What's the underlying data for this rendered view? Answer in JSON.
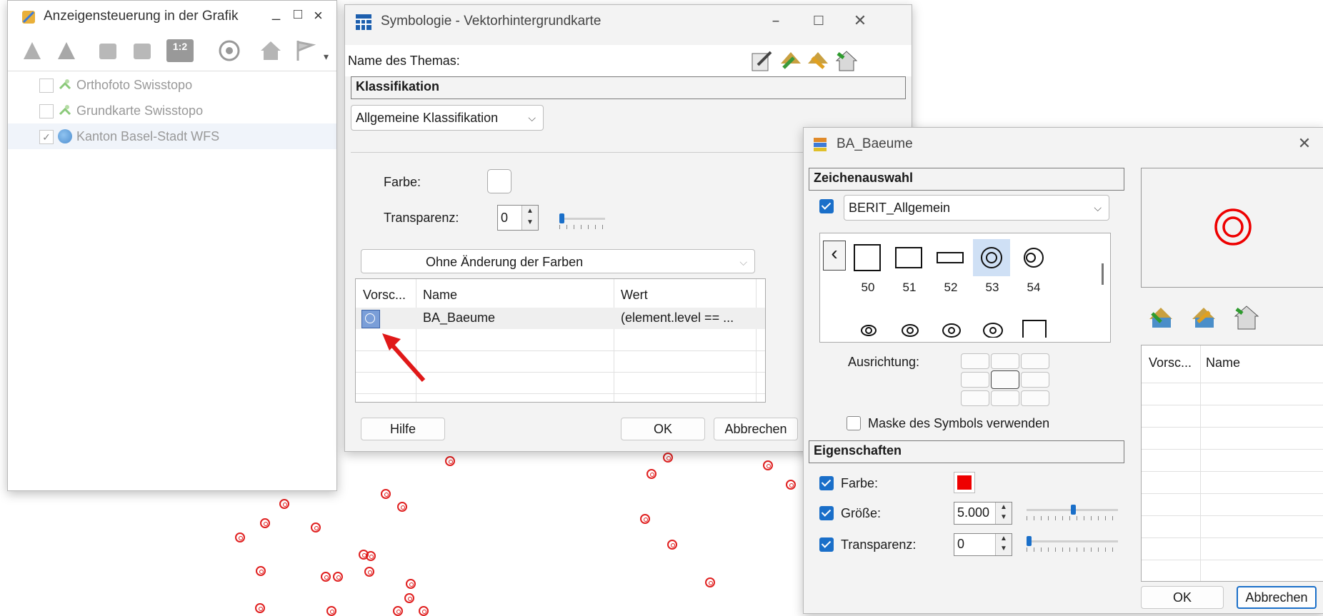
{
  "colors": {
    "accent": "#1a6fc9",
    "marker": "#e02020",
    "selected_bg": "#cfe0f5"
  },
  "layer_panel": {
    "title": "Anzeigensteuerung in der Grafik",
    "controls": [
      "_",
      "□",
      "×"
    ],
    "layers": [
      {
        "label": "Orthofoto Swisstopo",
        "checked": false,
        "icon": "satellite-icon"
      },
      {
        "label": "Grundkarte Swisstopo",
        "checked": false,
        "icon": "satellite-icon"
      },
      {
        "label": "Kanton Basel-Stadt WFS",
        "checked": true,
        "icon": "globe-icon"
      }
    ],
    "scale_button": "1:2"
  },
  "symbology": {
    "title": "Symbologie - Vektorhintergrundkarte",
    "theme_label": "Name des Themas:",
    "section_classification": "Klassifikation",
    "classification_select": "Allgemeine Klassifikation",
    "color_label": "Farbe:",
    "transparency_label": "Transparenz:",
    "transparency_value": "0",
    "color_mode_select": "Ohne Änderung der Farben",
    "table_headers": [
      "Vorsc...",
      "Name",
      "Wert"
    ],
    "rows": [
      {
        "name": "BA_Baeume",
        "value": "(element.level == ..."
      }
    ],
    "help_button": "Hilfe",
    "ok_button": "OK",
    "cancel_button": "Abbrechen"
  },
  "symbol_dialog": {
    "title": "BA_Baeume",
    "section_symbol": "Zeichenauswahl",
    "font_select": "BERIT_Allgemein",
    "symbols": [
      "50",
      "51",
      "52",
      "53",
      "54"
    ],
    "selected_symbol": "53",
    "alignment_label": "Ausrichtung:",
    "mask_label": "Maske des Symbols verwenden",
    "section_properties": "Eigenschaften",
    "color_label": "Farbe:",
    "size_label": "Größe:",
    "size_value": "5.000",
    "transparency_label": "Transparenz:",
    "transparency_value": "0",
    "table_headers": [
      "Vorsc...",
      "Name"
    ],
    "ok_button": "OK",
    "cancel_button": "Abbrechen"
  }
}
